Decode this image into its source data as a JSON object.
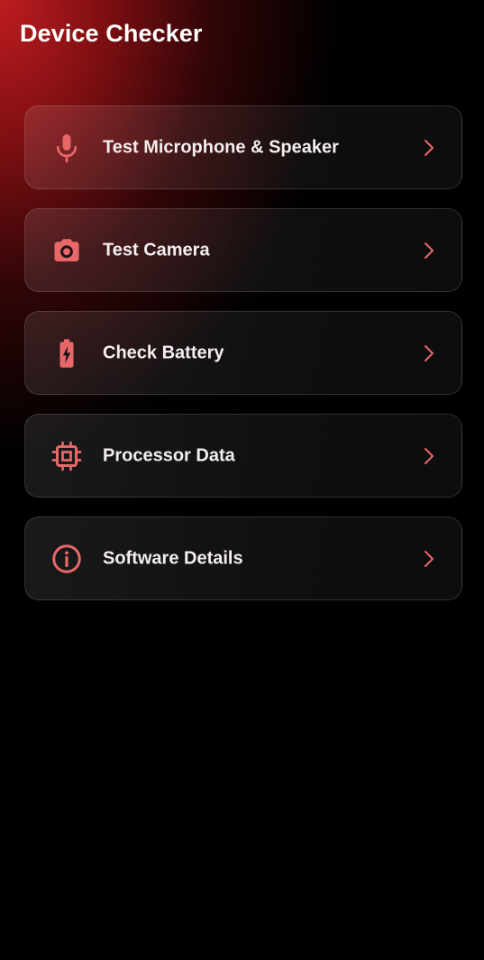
{
  "app": {
    "title": "Device Checker"
  },
  "colors": {
    "accent": "#e8686a",
    "background": "#000000",
    "header_gradient": "#b01a1e"
  },
  "menu": {
    "items": [
      {
        "label": "Test Microphone & Speaker",
        "icon": "microphone-icon"
      },
      {
        "label": "Test Camera",
        "icon": "camera-icon"
      },
      {
        "label": "Check Battery",
        "icon": "battery-icon"
      },
      {
        "label": "Processor Data",
        "icon": "processor-icon"
      },
      {
        "label": "Software Details",
        "icon": "info-icon"
      }
    ]
  }
}
